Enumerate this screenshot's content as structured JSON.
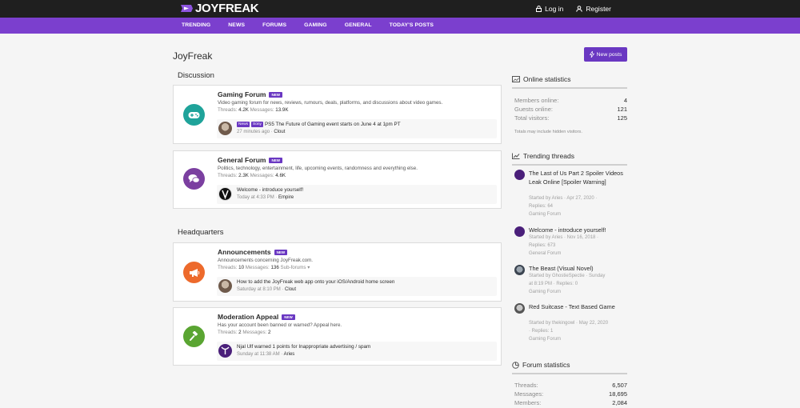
{
  "header": {
    "logo_text": "JOYFREAK",
    "login_label": "Log in",
    "register_label": "Register"
  },
  "nav": {
    "items": [
      {
        "label": "TRENDING"
      },
      {
        "label": "NEWS"
      },
      {
        "label": "FORUMS"
      },
      {
        "label": "GAMING"
      },
      {
        "label": "GENERAL"
      },
      {
        "label": "TODAY'S POSTS"
      }
    ]
  },
  "page": {
    "title": "JoyFreak",
    "new_posts_label": "New posts"
  },
  "sections": [
    {
      "title": "Discussion",
      "nodes": [
        {
          "title": "Gaming Forum",
          "badge": "NEW",
          "description": "Video gaming forum for news, reviews, rumours, deals, platforms, and discussions about video games.",
          "stats_threads_label": "Threads:",
          "threads": "4.2K",
          "stats_messages_label": "Messages:",
          "messages": "13.9K",
          "latest": {
            "tags": [
              "News",
              "Sony"
            ],
            "title": "PS5 The Future of Gaming event starts on June 4 at 1pm PT",
            "time": "27 minutes ago",
            "author": "Clout"
          }
        },
        {
          "title": "General Forum",
          "badge": "NEW",
          "description": "Politics, technology, entertainment, life, upcoming events, randomness and everything else.",
          "stats_threads_label": "Threads:",
          "threads": "2.3K",
          "stats_messages_label": "Messages:",
          "messages": "4.6K",
          "latest": {
            "tags": [],
            "title": "Welcome - introduce yourself!",
            "time": "Today at 4:33 PM",
            "author": "Empire"
          }
        }
      ]
    },
    {
      "title": "Headquarters",
      "nodes": [
        {
          "title": "Announcements",
          "badge": "NEW",
          "description": "Announcements concerning JoyFreak.com.",
          "stats_threads_label": "Threads:",
          "threads": "10",
          "stats_messages_label": "Messages:",
          "messages": "136",
          "subforums": "Sub-forums",
          "latest": {
            "tags": [],
            "title": "How to add the JoyFreak web app onto your iOS/Android home screen",
            "time": "Saturday at 8:10 PM",
            "author": "Clout"
          }
        },
        {
          "title": "Moderation Appeal",
          "badge": "NEW",
          "description": "Has your account been banned or warned? Appeal here.",
          "stats_threads_label": "Threads:",
          "threads": "2",
          "stats_messages_label": "Messages:",
          "messages": "2",
          "latest": {
            "tags": [],
            "title": "Njal Ulf warned 1 points for Inappropriate advertising / spam",
            "time": "Sunday at 11:38 AM",
            "author": "Aries"
          }
        }
      ]
    }
  ],
  "online": {
    "title": "Online statistics",
    "rows": [
      {
        "label": "Members online:",
        "value": "4"
      },
      {
        "label": "Guests online:",
        "value": "121"
      },
      {
        "label": "Total visitors:",
        "value": "125"
      }
    ],
    "note": "Totals may include hidden visitors."
  },
  "trending": {
    "title": "Trending threads",
    "items": [
      {
        "title": "The Last of Us Part 2 Spoiler Videos Leak Online [Spoiler Warning]",
        "meta1": "Started by Aries · Apr 27, 2020 ·",
        "meta2": "Replies: 64",
        "forum": "Gaming Forum"
      },
      {
        "title": "Welcome - introduce yourself!",
        "meta1": "Started by Aries · Nov 16, 2018 ·",
        "meta2": "Replies: 673",
        "forum": "General Forum"
      },
      {
        "title": "The Beast (Visual Novel)",
        "meta1": "Started by GhostieSpectie · Sunday",
        "meta2": "at 8:19 PM · Replies: 0",
        "forum": "Gaming Forum"
      },
      {
        "title": "Red Suitcase - Text Based Game",
        "meta1": "Started by thekingowl · May 22, 2020",
        "meta2": "· Replies: 1",
        "forum": "Gaming Forum"
      }
    ]
  },
  "forum_stats": {
    "title": "Forum statistics",
    "rows": [
      {
        "label": "Threads:",
        "value": "6,507"
      },
      {
        "label": "Messages:",
        "value": "18,695"
      },
      {
        "label": "Members:",
        "value": "2,084"
      }
    ]
  },
  "colors": {
    "brand_purple": "#7b3fce",
    "topbar": "#1f1f1f",
    "gaming_icon": "#1fa39a",
    "general_icon": "#7b3fa0",
    "announce_icon": "#ed6a2c",
    "appeal_icon": "#5aa532"
  }
}
